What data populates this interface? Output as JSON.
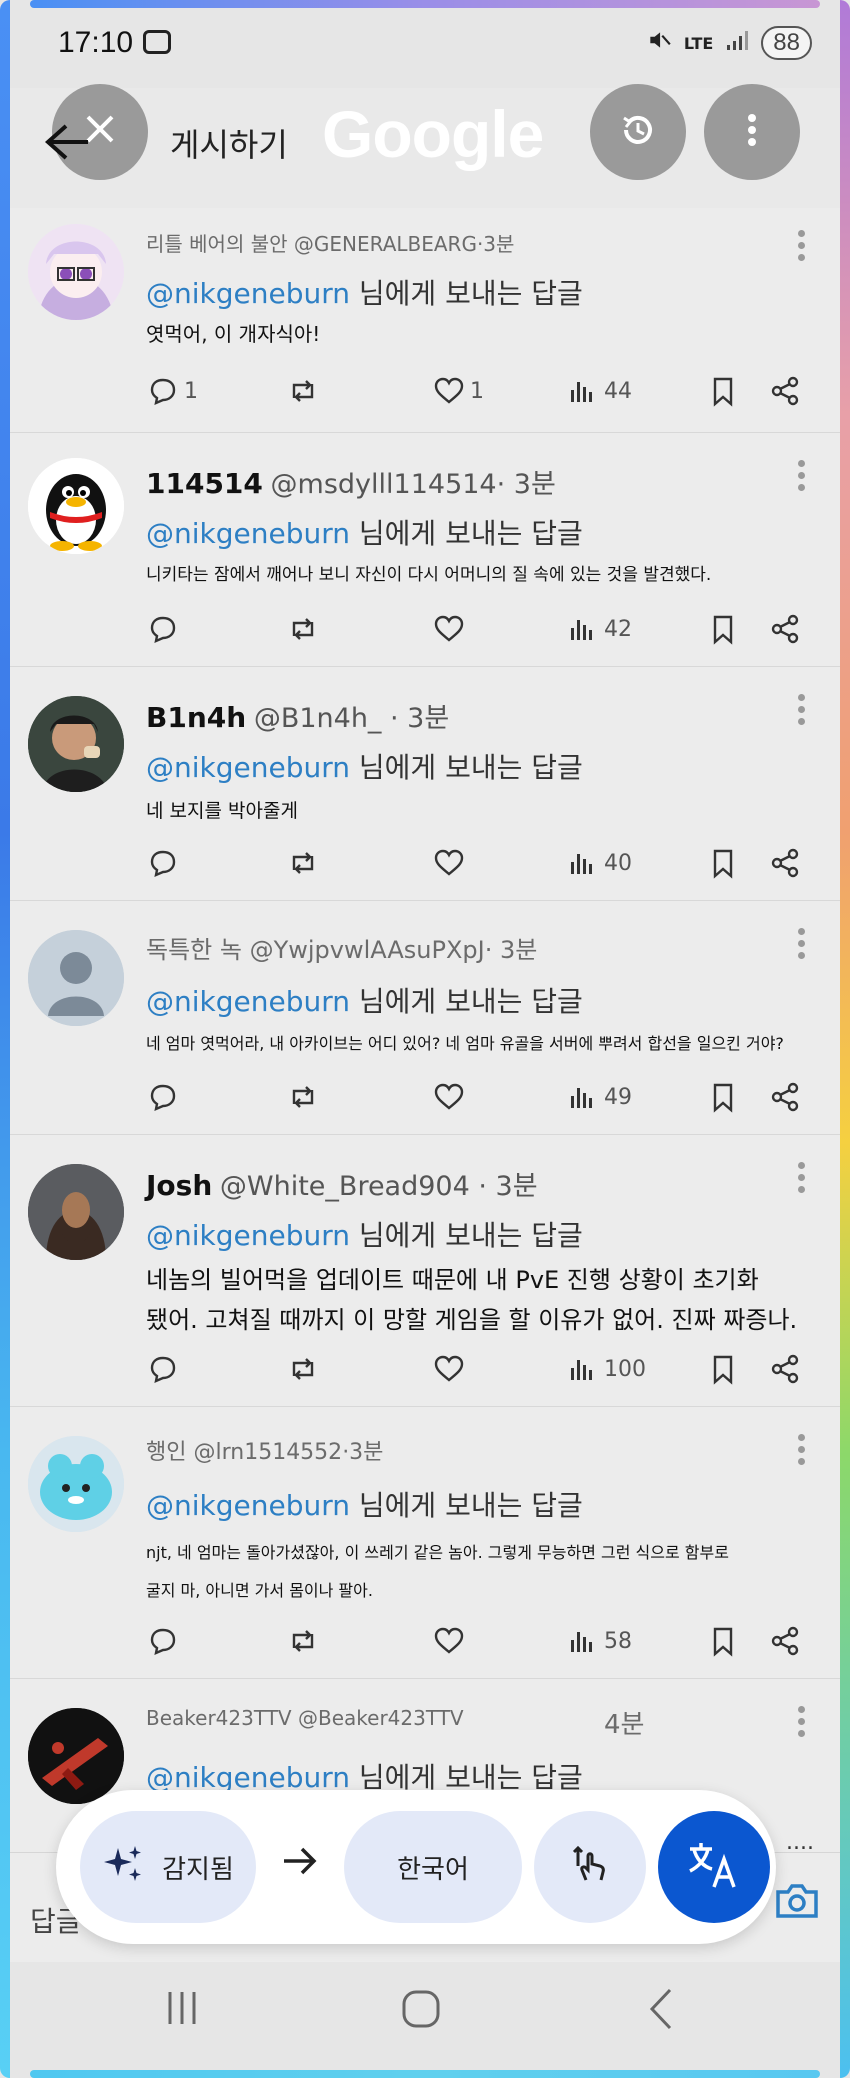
{
  "status_bar": {
    "time": "17:10",
    "network": "LTE",
    "battery": "88"
  },
  "toolbar": {
    "title": "게시하기",
    "logo": "Google"
  },
  "tweets": [
    {
      "name": "리틀 베어의 불안",
      "handle": "@GENERALBEARG",
      "time": "·3분",
      "reply_prefix": "@nikgeneburn",
      "reply_suffix": " 님에게 보내는 답글",
      "text": "엿먹어, 이 개자식아!",
      "replies": "1",
      "retweets": "",
      "likes": "1",
      "views": "44"
    },
    {
      "name": "114514",
      "handle": "@msdylll114514",
      "time": "· 3분",
      "reply_prefix": "@nikgeneburn",
      "reply_suffix": " 님에게 보내는 답글",
      "text": "니키타는 잠에서 깨어나 보니 자신이 다시 어머니의 질 속에 있는 것을 발견했다.",
      "replies": "",
      "retweets": "",
      "likes": "",
      "views": "42"
    },
    {
      "name": "B1n4h",
      "handle": "@B1n4h_",
      "time": " · 3분",
      "reply_prefix": "@nikgeneburn",
      "reply_suffix": " 님에게 보내는 답글",
      "text": "네 보지를 박아줄게",
      "replies": "",
      "retweets": "",
      "likes": "",
      "views": "40"
    },
    {
      "name": "독특한 녹",
      "handle": "@YwjpvwlAAsuPXpJ·",
      "time": "  3분",
      "reply_prefix": "@nikgeneburn",
      "reply_suffix": " 님에게 보내는 답글",
      "text": "네 엄마 엿먹어라, 내 아카이브는 어디 있어? 네 엄마 유골을 서버에 뿌려서 합선을 일으킨 거야?",
      "replies": "",
      "retweets": "",
      "likes": "",
      "views": "49"
    },
    {
      "name": "Josh",
      "handle": "@White_Bread904",
      "time": " · 3분",
      "reply_prefix": "@nikgeneburn",
      "reply_suffix": " 님에게 보내는 답글",
      "text_line1": "네놈의 빌어먹을 업데이트 때문에 내 PvE 진행 상황이 초기화",
      "text_line2": "됐어. 고쳐질 때까지 이 망할 게임을 할 이유가 없어. 진짜 짜증나.",
      "replies": "",
      "retweets": "",
      "likes": "",
      "views": "100"
    },
    {
      "name": "행인",
      "handle": "@lrn1514552",
      "time": "·3분",
      "reply_prefix": "@nikgeneburn",
      "reply_suffix": " 님에게 보내는 답글",
      "text_line1": "njt, 네 엄마는 돌아가셨잖아, 이 쓰레기 같은 놈아. 그렇게 무능하면 그런 식으로 함부로",
      "text_line2": "굴지 마, 아니면 가서 몸이나 팔아.",
      "replies": "",
      "retweets": "",
      "likes": "",
      "views": "58"
    },
    {
      "name": "Beaker423TTV",
      "handle": "@Beaker423TTV",
      "time": "4분",
      "reply_prefix": "@nikgeneburn",
      "reply_suffix": " 님에게 보내는 답글"
    }
  ],
  "translate_bar": {
    "source": "감지됨",
    "target": "한국어",
    "ellipsis": "...."
  },
  "reply_box": {
    "placeholder": "답글"
  },
  "icons": {
    "back": "back-arrow-icon",
    "close": "close-icon",
    "history": "history-icon",
    "more": "more-vert-icon",
    "reply": "comment-icon",
    "retweet": "retweet-icon",
    "like": "heart-icon",
    "views": "views-chart-icon",
    "bookmark": "bookmark-icon",
    "share": "share-icon",
    "sparkle": "sparkle-icon",
    "gesture": "touch-gesture-icon",
    "translate": "translate-icon",
    "camera": "camera-icon"
  },
  "colors": {
    "mention": "#2d7fc4",
    "translate_fab": "#0b57d0",
    "chip_bg": "#e3e9f8"
  }
}
